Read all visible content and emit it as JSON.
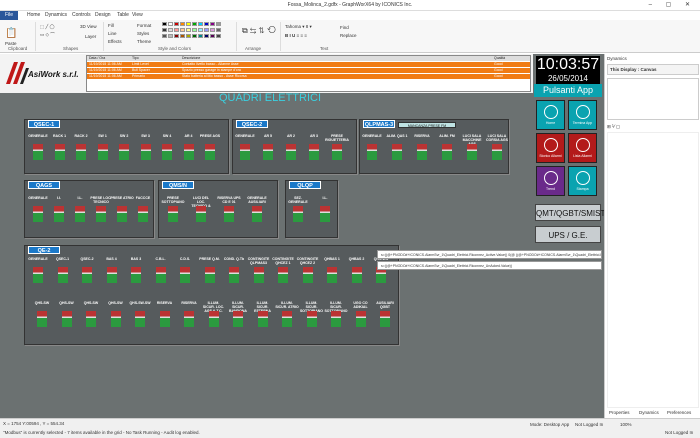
{
  "window": {
    "title": "Fossa_Molinca_2.gdfx - GraphWorX64 by ICONICS Inc.",
    "controls": "– ▢ ✕"
  },
  "ribbon_tabs": [
    "File",
    "Home",
    "Dynamics",
    "Controls",
    "Design",
    "Table",
    "View"
  ],
  "ribbon": {
    "groups": [
      "Clipboard",
      "Shapes",
      "Style and Colors",
      "Arrange",
      "Text"
    ],
    "buttons": {
      "paste": "Paste",
      "view3d": "3D View",
      "layer": "Layer",
      "fill": "Fill",
      "line": "Line",
      "effects": "Effects",
      "format": "Format",
      "styles": "Styles",
      "theme": "Theme",
      "find": "Find",
      "replace": "Replace"
    }
  },
  "logo": {
    "text": "AsiWork s.r.l."
  },
  "alarms": {
    "headers": [
      "Data / Ora",
      "Tipo",
      "Descrizione",
      "Qualità"
    ],
    "rows": [
      {
        "time": "11/19/2015 11:06 AM",
        "type": "Limit Level",
        "desc": "Contatto livello basso - Allarme Asse",
        "q": "Good"
      },
      {
        "time": "11/19/2015 11:06 AM",
        "type": "Bull Spacer",
        "desc": "Spazio presso garage in stampe d'ora",
        "q": "Good"
      },
      {
        "time": "11/19/2015 11:06 AM",
        "type": "Primario",
        "desc": "Stato batteria al litio basso - Asse Ricorsa",
        "q": "Good"
      }
    ]
  },
  "clock": {
    "time": "10:03:57",
    "date": "26/05/2014"
  },
  "pulsanti": {
    "title": "Pulsanti App",
    "buttons": [
      {
        "label": "Home",
        "color": "#0aa3b0"
      },
      {
        "label": "Termina App",
        "color": "#0aa3b0"
      },
      {
        "label": "Storico Allarmi",
        "color": "#b31a1a"
      },
      {
        "label": "Lista Allarmi",
        "color": "#b31a1a"
      },
      {
        "label": "Trend",
        "color": "#6a2a8a"
      },
      {
        "label": "Stampa",
        "color": "#0aa3b0"
      }
    ]
  },
  "big_buttons": [
    "QMT/QGBT/SMIST.",
    "UPS / G.E."
  ],
  "main_title": "QUADRI ELETTRICI",
  "panels": {
    "qsec1": {
      "tag": "QSEC-1",
      "labels": [
        "GENERALE",
        "RACK 1",
        "RACK 2",
        "SW 1",
        "SW 2",
        "SW 3",
        "SW 4",
        "AR 4",
        "PRESE AGS"
      ]
    },
    "qsec2": {
      "tag": "QSEC-2",
      "labels": [
        "GENERALE",
        "AR 5",
        "AR 2",
        "AR 3",
        "PRESE RIGUETTERIA"
      ]
    },
    "qlpmas": {
      "tag": "QLPMAS-3",
      "note": "MANCANZA PRESE FM",
      "labels": [
        "GENERALE",
        "ALIM. QAS 1",
        "RISERVA",
        "ALIM. FM",
        "LUCI SALA MACCHINE AGS",
        "LUCI SALA CORSIA AGS"
      ]
    },
    "qags": {
      "tag": "QAGS",
      "labels": [
        "GENERALE",
        "I.I.",
        "I.L.",
        "PRESE LOC. TECNICO",
        "PRESE ATRIO",
        "FACCCE"
      ]
    },
    "qms": {
      "tag": "QMS/N",
      "labels": [
        "PRESE SOTTOPIANO",
        "LUCI DEL LOC. TECNICO & AGS",
        "RISERVA UPS CD E 01",
        "GENERALE AUSILIARI"
      ]
    },
    "qlqp": {
      "tag": "QLQP",
      "labels": [
        "SEZ. GENERALE",
        "I.L."
      ]
    },
    "qe2": {
      "tag": "QE-2",
      "top_labels": [
        "GENERALE",
        "QSEC-1",
        "QSEC-2",
        "BAS 4",
        "BAS 3",
        "C.B.L.",
        "C.D.S.",
        "PRESE Q.M.",
        "COND. Q.Tb",
        "CONTINGITE QLPMAS3",
        "CONTINGITE QHCEZ 1",
        "CONTINGITE QHCEZ 2",
        "QHBAS 1",
        "QHBAS 2",
        "QHS-WS"
      ],
      "bottom_labels": [
        "QHS-SW",
        "QHS-SW",
        "QHS-SW",
        "QHS-SW",
        "QHS-SW-SW",
        "RISERVA",
        "RISERVA",
        "ILLUM. SICUR. LOC. AGS & T.C.",
        "ILLUM. SICUR. BANDONA",
        "ILLUM. SICUR. ESTERNA",
        "ILLUM. SICUR. ATRIO",
        "ILLUM. SICUR. SOTTOPIANO 1",
        "ILLUM. SICUR. SOTTOPIANO 2",
        "UGO CO ADIKIAL",
        "AUSILIARI QGBT"
      ]
    }
  },
  "tooltips": [
    "s=((@+PNODO#+ICONICS.AlarmSvr_1\\Quadri_Elettrici.Riconnez_Active.Value)) 0(@ ((@+PNODO#+ICONICS.AlarmSvr_1\\Quadri_Elettrici.Riconnez_UnAcked.Value)",
    "s=((@+PNODO#+ICONICS.AlarmSvr_1\\Quadri_Elettrici.Riconnez_UnAcked.Value))"
  ],
  "right_panel": {
    "title": "Dynamics",
    "display": "This Display : Canvas",
    "tabs": [
      "Properties",
      "Dynamics",
      "Preferences"
    ]
  },
  "status": {
    "coords": "X = 1754 Y:00594 , Y = 554.34",
    "left": "\"Modbus\" is currently selected - 7 items available in the grid - No Task Running - Audit log enabled.",
    "mode": "Mode: Desktop App",
    "logged": "Not Logged In",
    "zoom": "100%",
    "logged2": "Not Logged In"
  }
}
